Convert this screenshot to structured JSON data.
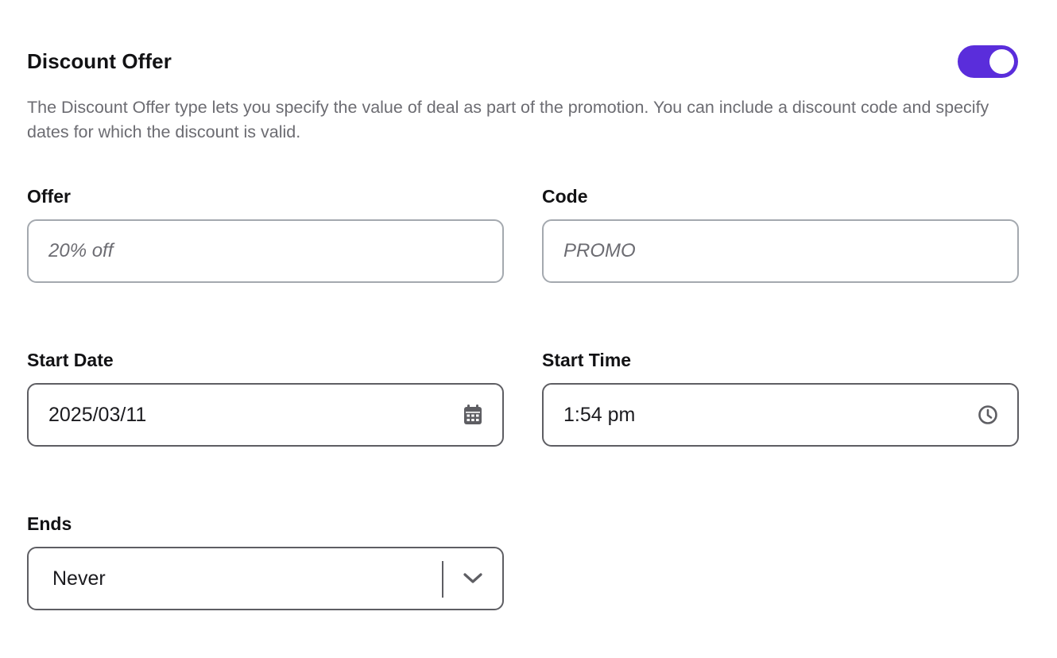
{
  "header": {
    "title": "Discount Offer",
    "toggle_on": true,
    "accent_color": "#5a2ddb"
  },
  "description": "The Discount Offer type lets you specify the value of deal as part of the promotion. You can include a discount code and specify dates for which the discount is valid.",
  "fields": {
    "offer": {
      "label": "Offer",
      "value": "",
      "placeholder": "20% off"
    },
    "code": {
      "label": "Code",
      "value": "",
      "placeholder": "PROMO"
    },
    "start_date": {
      "label": "Start Date",
      "value": "2025/03/11",
      "icon": "calendar-icon"
    },
    "start_time": {
      "label": "Start Time",
      "value": "1:54 pm",
      "icon": "clock-icon"
    },
    "ends": {
      "label": "Ends",
      "value": "Never",
      "icon": "chevron-down-icon"
    }
  }
}
